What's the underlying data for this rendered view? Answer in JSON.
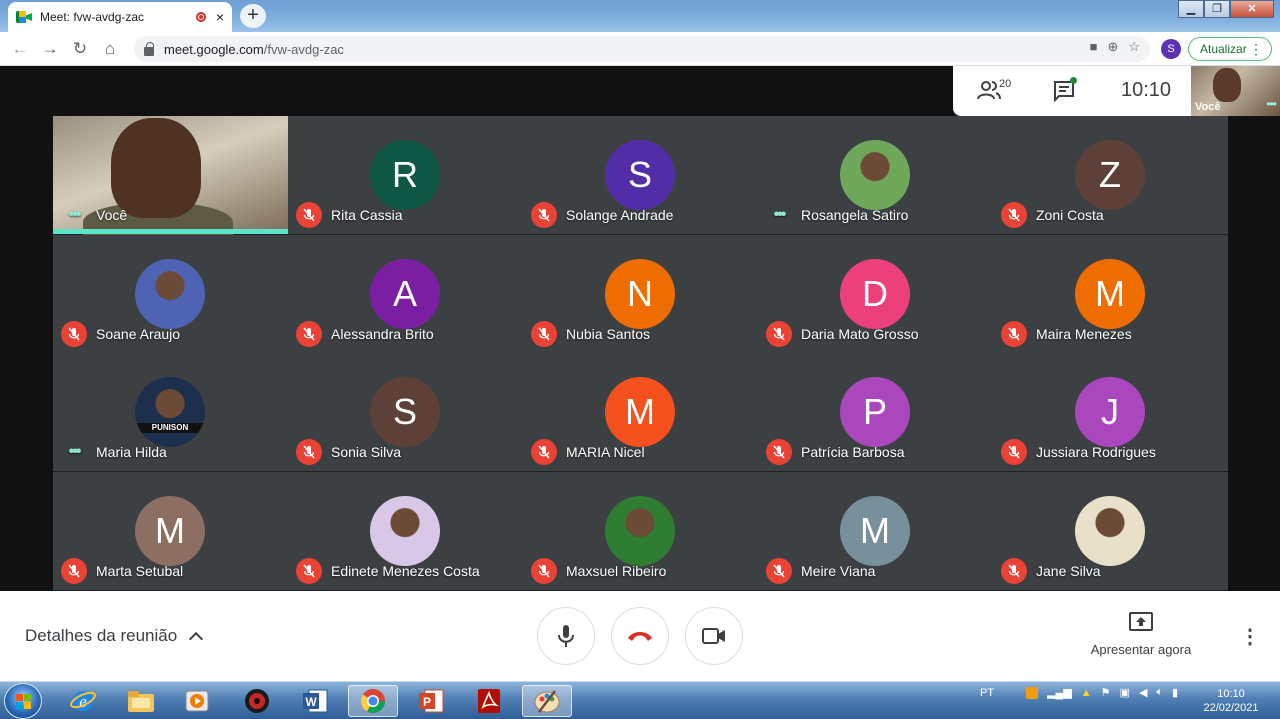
{
  "browser": {
    "tab_title": "Meet: fvw-avdg-zac",
    "tab_close": "×",
    "new_tab": "+",
    "url_host": "meet.google.com",
    "url_path": "/fvw-avdg-zac",
    "profile_initial": "S",
    "update_label": "Atualizar"
  },
  "meet": {
    "participant_count": "20",
    "clock": "10:10",
    "self_preview_label": "Você",
    "participants": [
      {
        "name": "Você",
        "avatar_type": "self-video",
        "status": "speaking"
      },
      {
        "name": "Rita Cassia",
        "initial": "R",
        "color": "#0f5846",
        "status": "muted"
      },
      {
        "name": "Solange Andrade",
        "initial": "S",
        "color": "#512da8",
        "status": "muted"
      },
      {
        "name": "Rosangela Satiro",
        "avatar_type": "photo",
        "photo_tone": "#6fa85a",
        "status": "audio"
      },
      {
        "name": "Zoni Costa",
        "initial": "Z",
        "color": "#5d4037",
        "status": "muted"
      },
      {
        "name": "Soane Araujo",
        "avatar_type": "photo",
        "photo_tone": "#4e63b3",
        "status": "muted"
      },
      {
        "name": "Alessandra Brito",
        "initial": "A",
        "color": "#7b1fa2",
        "status": "muted"
      },
      {
        "name": "Nubia Santos",
        "initial": "N",
        "color": "#ef6c00",
        "status": "muted"
      },
      {
        "name": "Daria Mato Grosso",
        "initial": "D",
        "color": "#ec407a",
        "status": "muted"
      },
      {
        "name": "Maira Menezes",
        "initial": "M",
        "color": "#ef6c00",
        "status": "muted"
      },
      {
        "name": "Maria Hilda",
        "avatar_type": "photo",
        "photo_tone": "#1c2f4d",
        "photo_text": "PUNISON",
        "status": "audio"
      },
      {
        "name": "Sonia Silva",
        "initial": "S",
        "color": "#5d4037",
        "status": "muted"
      },
      {
        "name": "MARIA Nicel",
        "initial": "M",
        "color": "#f4511e",
        "status": "muted"
      },
      {
        "name": "Patrícia Barbosa",
        "initial": "P",
        "color": "#ab47bc",
        "status": "muted"
      },
      {
        "name": "Jussiara Rodrigues",
        "initial": "J",
        "color": "#ab47bc",
        "status": "muted"
      },
      {
        "name": "Marta Setubal",
        "initial": "M",
        "color": "#8d6e63",
        "status": "muted"
      },
      {
        "name": "Edinete Menezes Costa",
        "avatar_type": "photo",
        "photo_tone": "#d9c7e8",
        "status": "muted"
      },
      {
        "name": "Maxsuel Ribeiro",
        "avatar_type": "photo",
        "photo_tone": "#2e7d32",
        "status": "muted"
      },
      {
        "name": "Meire Viana",
        "initial": "M",
        "color": "#78909c",
        "status": "muted"
      },
      {
        "name": "Jane Silva",
        "avatar_type": "photo",
        "photo_tone": "#e8e0c8",
        "status": "muted"
      }
    ]
  },
  "controls": {
    "details_label": "Detalhes da reunião",
    "present_label": "Apresentar agora",
    "icons": [
      "mic-icon",
      "hangup-icon",
      "camera-icon",
      "present-screen-icon",
      "more-options-icon"
    ]
  },
  "taskbar": {
    "language": "PT",
    "time": "10:10",
    "date": "22/02/2021",
    "apps": [
      "internet-explorer",
      "file-explorer",
      "media-player",
      "game-app",
      "word",
      "chrome",
      "powerpoint",
      "acrobat",
      "paint"
    ]
  }
}
